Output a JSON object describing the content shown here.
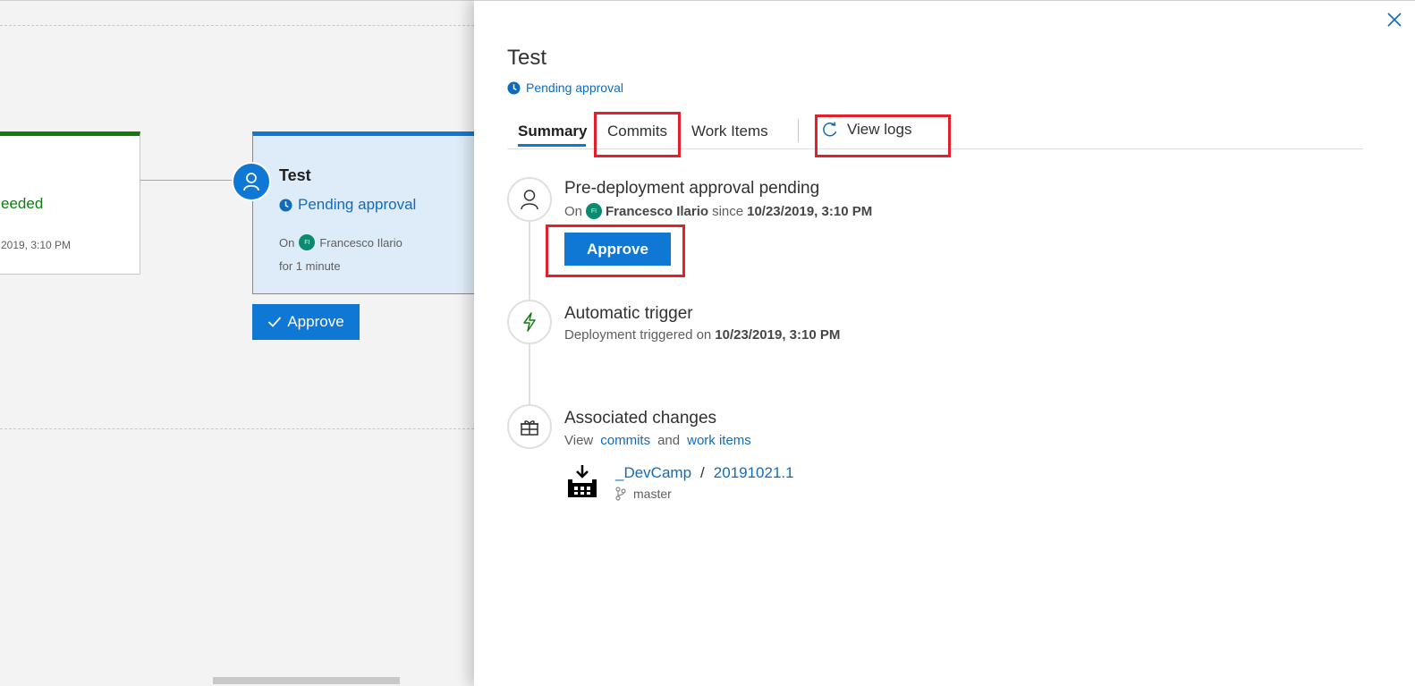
{
  "canvas": {
    "prev_stage": {
      "status": "eeded",
      "date": "2019, 3:10 PM"
    },
    "stage": {
      "title": "Test",
      "status": "Pending approval",
      "on_label": "On",
      "avatar_initials": "FI",
      "user": "Francesco Ilario",
      "duration": "for 1 minute"
    },
    "approve_label": "Approve"
  },
  "panel": {
    "title": "Test",
    "status": "Pending approval",
    "tabs": [
      {
        "label": "Summary",
        "active": true
      },
      {
        "label": "Commits",
        "active": false
      },
      {
        "label": "Work Items",
        "active": false
      }
    ],
    "view_logs": "View logs",
    "timeline": {
      "approval": {
        "title": "Pre-deployment approval pending",
        "on_label": "On",
        "avatar_initials": "FI",
        "user": "Francesco Ilario",
        "since_label": "since",
        "date": "10/23/2019, 3:10 PM",
        "approve_label": "Approve"
      },
      "trigger": {
        "title": "Automatic trigger",
        "text": "Deployment triggered on",
        "date": "10/23/2019, 3:10 PM"
      },
      "changes": {
        "title": "Associated changes",
        "view_label": "View",
        "commits_link": "commits",
        "and_label": "and",
        "workitems_link": "work items",
        "artifact_name": "_DevCamp",
        "separator": "/",
        "build": "20191021.1",
        "branch": "master"
      }
    }
  },
  "colors": {
    "accent": "#0f78d4",
    "success": "#107c10",
    "highlight": "#e3202a"
  },
  "icons": [
    "user-icon",
    "clock-icon",
    "check-icon",
    "close-icon",
    "refresh-icon",
    "lightning-icon",
    "gift-icon",
    "artifact-icon",
    "branch-icon"
  ]
}
